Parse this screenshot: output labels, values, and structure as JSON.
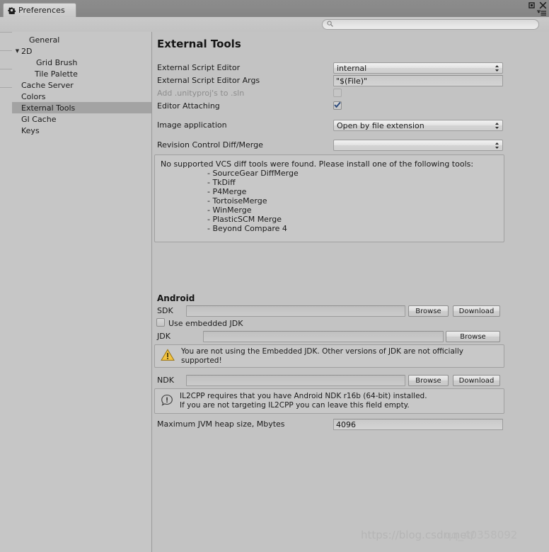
{
  "window": {
    "tab_label": "Preferences",
    "tab_icon": "gear-icon",
    "maximize_icon": "maximize-icon",
    "close_icon": "close-icon",
    "menu_icon": "hamburger-menu-icon"
  },
  "search": {
    "value": "",
    "placeholder": "",
    "icon": "search-icon"
  },
  "sidebar": {
    "items": [
      {
        "label": "General",
        "indent": 1,
        "twisty": "",
        "selected": false
      },
      {
        "label": "2D",
        "indent": 0,
        "twisty": "▼",
        "selected": false
      },
      {
        "label": "Grid Brush",
        "indent": 2,
        "twisty": "",
        "selected": false
      },
      {
        "label": "Tile Palette",
        "indent": 2,
        "twisty": "",
        "selected": false
      },
      {
        "label": "Cache Server",
        "indent": 1,
        "twisty": "",
        "selected": false
      },
      {
        "label": "Colors",
        "indent": 1,
        "twisty": "",
        "selected": false
      },
      {
        "label": "External Tools",
        "indent": 1,
        "twisty": "",
        "selected": true
      },
      {
        "label": "GI Cache",
        "indent": 1,
        "twisty": "",
        "selected": false
      },
      {
        "label": "Keys",
        "indent": 1,
        "twisty": "",
        "selected": false
      }
    ]
  },
  "main": {
    "title": "External Tools",
    "fields": {
      "script_editor_label": "External Script Editor",
      "script_editor_value": "internal",
      "script_editor_args_label": "External Script Editor Args",
      "script_editor_args_value": "\"$(File)\"",
      "unityproj_label": "Add .unityproj's to .sln",
      "unityproj_checked": false,
      "editor_attaching_label": "Editor Attaching",
      "editor_attaching_checked": true,
      "image_application_label": "Image application",
      "image_application_value": "Open by file extension",
      "revision_control_label": "Revision Control Diff/Merge",
      "revision_control_value": ""
    },
    "vcs_help": {
      "message": "No supported VCS diff tools were found. Please install one of the following tools:",
      "tools": [
        "- SourceGear DiffMerge",
        "- TkDiff",
        "- P4Merge",
        "- TortoiseMerge",
        "- WinMerge",
        "- PlasticSCM Merge",
        "- Beyond Compare 4"
      ]
    },
    "android": {
      "section_label": "Android",
      "sdk_label": "SDK",
      "sdk_value": "",
      "sdk_browse": "Browse",
      "sdk_download": "Download",
      "embedded_jdk_label": "Use embedded JDK",
      "embedded_jdk_checked": false,
      "jdk_label": "JDK",
      "jdk_value": "",
      "jdk_browse": "Browse",
      "jdk_warning": "You are not using the Embedded JDK. Other versions of JDK are not officially supported!",
      "jdk_warning_icon": "warning-triangle-icon",
      "ndk_label": "NDK",
      "ndk_value": "",
      "ndk_browse": "Browse",
      "ndk_download": "Download",
      "ndk_info_line1": "IL2CPP requires that you have Android NDK r16b (64-bit) installed.",
      "ndk_info_line2": "If you are not targeting IL2CPP you can leave this field empty.",
      "ndk_info_icon": "info-bubble-icon",
      "heap_label": "Maximum JVM heap size, Mbytes",
      "heap_value": "4096"
    }
  },
  "watermark": {
    "text": "https://blog.csdn.net/",
    "overlap": "qq_40358092"
  },
  "colors": {
    "window_bg": "#c3c3c3",
    "panel_bg": "#c6c6c6",
    "selection": "#a3a3a3",
    "titlebar": "#8a8a8a",
    "warning": "#f2c14b",
    "checkbox_check": "#2c4a7c"
  }
}
